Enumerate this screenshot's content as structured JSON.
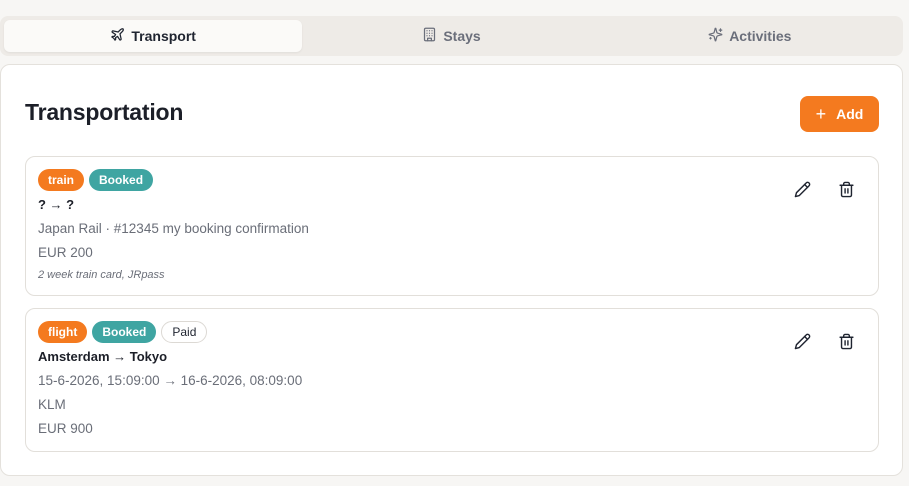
{
  "tabs": [
    {
      "label": "Transport",
      "icon": "plane-icon",
      "active": true
    },
    {
      "label": "Stays",
      "icon": "building-icon",
      "active": false
    },
    {
      "label": "Activities",
      "icon": "sparkles-icon",
      "active": false
    }
  ],
  "main": {
    "title": "Transportation",
    "add_label": "Add"
  },
  "items": [
    {
      "badges": [
        "train",
        "Booked"
      ],
      "route": "? → ?",
      "provider": "Japan Rail · #12345 my booking confirmation",
      "price": "EUR 200",
      "note": "2 week train card, JRpass"
    },
    {
      "badges": [
        "flight",
        "Booked",
        "Paid"
      ],
      "route": "Amsterdam → Tokyo",
      "dates": "15-6-2026, 15:09:00 → 16-6-2026, 08:09:00",
      "provider": "KLM",
      "price": "EUR 900"
    }
  ],
  "colors": {
    "accent": "#f47a1f",
    "booked": "#3fa5a2"
  }
}
